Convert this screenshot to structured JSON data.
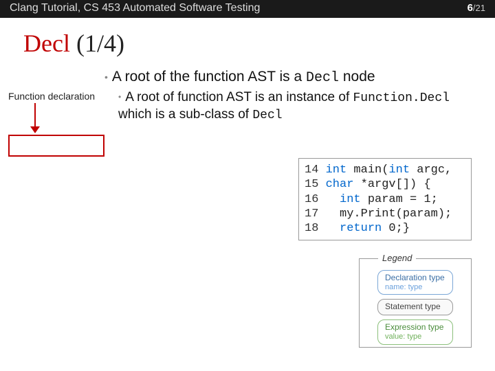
{
  "header": {
    "left": "Clang Tutorial, CS 453 Automated Software Testing",
    "page": "6",
    "total": "/21"
  },
  "title": {
    "main": "Decl",
    "frac": " (1/4)"
  },
  "bullets": {
    "b1_pre": "A root of the function AST is a ",
    "b1_mono": "Decl",
    "b1_post": " node",
    "b2_pre": "A root of function AST is an instance of ",
    "b2_mono1": "Function.Decl",
    "b2_mid": " which is a sub-class of ",
    "b2_mono2": "Decl"
  },
  "annot": {
    "func_decl": "Function declaration"
  },
  "code": {
    "lines": [
      {
        "n": "14",
        "pre": " ",
        "kw1": "int",
        "t1": " main(",
        "kw2": "int",
        "t2": " argc,"
      },
      {
        "n": "15",
        "pre": " ",
        "kw1": "char",
        "t1": " *argv[]) {",
        "kw2": "",
        "t2": ""
      },
      {
        "n": "16",
        "pre": "   ",
        "kw1": "int",
        "t1": " param = 1;",
        "kw2": "",
        "t2": ""
      },
      {
        "n": "17",
        "pre": "   ",
        "kw1": "",
        "t1": "my.Print(param);",
        "kw2": "",
        "t2": ""
      },
      {
        "n": "18",
        "pre": "   ",
        "kw1": "return",
        "t1": " 0;}",
        "kw2": "",
        "t2": ""
      }
    ]
  },
  "legend": {
    "title": "Legend",
    "decl": {
      "line1": "Declaration type",
      "line2": "name: type"
    },
    "stmt": {
      "line1": "Statement type"
    },
    "expr": {
      "line1": "Expression type",
      "line2": "value: type"
    }
  }
}
